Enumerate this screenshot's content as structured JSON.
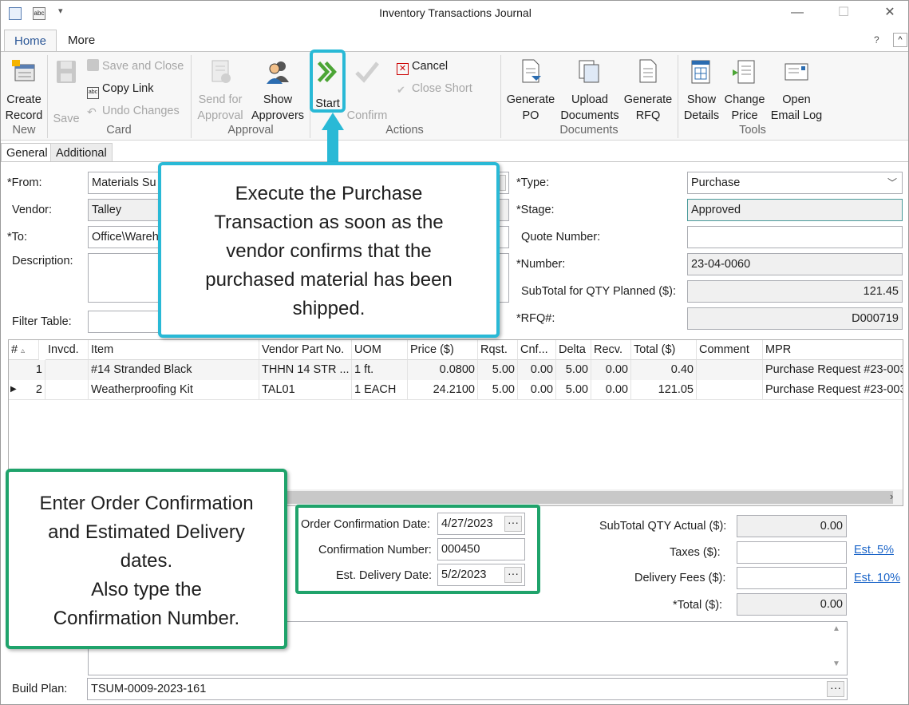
{
  "window": {
    "title": "Inventory Transactions Journal"
  },
  "ribbon_tabs": [
    "Home",
    "More"
  ],
  "ribbon": {
    "new": {
      "create_record": [
        "Create",
        "Record"
      ],
      "label": "New"
    },
    "card": {
      "save": "Save",
      "save_and_close": "Save and Close",
      "copy_link": "Copy Link",
      "undo_changes": "Undo Changes",
      "label": "Card"
    },
    "approval": {
      "send_for_approval": [
        "Send for",
        "Approval"
      ],
      "show_approvers": [
        "Show",
        "Approvers"
      ],
      "label": "Approval"
    },
    "actions": {
      "start": "Start",
      "confirm": "Confirm",
      "cancel": "Cancel",
      "close_short": "Close Short",
      "label": "Actions"
    },
    "documents": {
      "generate_po": [
        "Generate",
        "PO"
      ],
      "upload_documents": [
        "Upload",
        "Documents"
      ],
      "generate_rfq": [
        "Generate",
        "RFQ"
      ],
      "label": "Documents"
    },
    "tools": {
      "show_details": [
        "Show",
        "Details"
      ],
      "change_price": [
        "Change",
        "Price"
      ],
      "open_email_log": [
        "Open",
        "Email Log"
      ],
      "label": "Tools"
    }
  },
  "form_tabs": [
    "General",
    "Additional"
  ],
  "form": {
    "from_label": "*From:",
    "from_value": "Materials Su",
    "vendor_label": "Vendor:",
    "vendor_value": "Talley",
    "to_label": "*To:",
    "to_value": "Office\\Wareh",
    "description_label": "Description:",
    "filter_label": "Filter Table:",
    "type_label": "*Type:",
    "type_value": "Purchase",
    "stage_label": "*Stage:",
    "stage_value": "Approved",
    "quote_label": "Quote Number:",
    "quote_value": "",
    "number_label": "*Number:",
    "number_value": "23-04-0060",
    "subtotal_planned_label": "SubTotal for QTY Planned ($):",
    "subtotal_planned_value": "121.45",
    "rfq_label": "*RFQ#:",
    "rfq_value": "D000719"
  },
  "grid": {
    "columns": [
      "#",
      "Invcd.",
      "Item",
      "Vendor Part No.",
      "UOM",
      "Price ($)",
      "Rqst.",
      "Cnf...",
      "Delta",
      "Recv.",
      "Total ($)",
      "Comment",
      "MPR"
    ],
    "rows": [
      [
        "1",
        "",
        "#14 Stranded Black",
        "THHN 14 STR ...",
        "1 ft.",
        "0.0800",
        "5.00",
        "0.00",
        "5.00",
        "0.00",
        "0.40",
        "",
        "Purchase Request #23-003"
      ],
      [
        "2",
        "",
        "Weatherproofing Kit",
        "TAL01",
        "1 EACH",
        "24.2100",
        "5.00",
        "0.00",
        "5.00",
        "0.00",
        "121.05",
        "",
        "Purchase Request #23-003"
      ]
    ]
  },
  "bottom": {
    "order_conf_date_label": "Order Confirmation Date:",
    "order_conf_date_value": "4/27/2023",
    "conf_number_label": "Confirmation Number:",
    "conf_number_value": "000450",
    "est_delivery_label": "Est. Delivery Date:",
    "est_delivery_value": "5/2/2023",
    "subtotal_actual_label": "SubTotal QTY Actual ($):",
    "subtotal_actual_value": "0.00",
    "taxes_label": "Taxes ($):",
    "taxes_value": "",
    "taxes_link": "Est. 5%",
    "delivery_fees_label": "Delivery Fees ($):",
    "delivery_fees_value": "",
    "delivery_fees_link": "Est. 10%",
    "total_label": "*Total ($):",
    "total_value": "0.00",
    "build_plan_label": "Build Plan:",
    "build_plan_value": "TSUM-0009-2023-161"
  },
  "callouts": {
    "blue": [
      "Execute the Purchase",
      "Transaction as soon as the",
      "vendor confirms that the",
      "purchased material has been",
      "shipped."
    ],
    "green": [
      "Enter Order Confirmation",
      "and Estimated Delivery",
      "dates.",
      "Also type the",
      "Confirmation Number."
    ]
  },
  "colors": {
    "callout_blue": "#29b9d6",
    "callout_green": "#1fa36b",
    "active_tab": "#2b5797",
    "link": "#1a64c8"
  },
  "icons": [
    "save-icon",
    "start-icon",
    "confirm-icon",
    "cancel-icon",
    "close-short-icon",
    "undo-icon",
    "copy-link-icon",
    "generate-po-icon",
    "upload-documents-icon",
    "generate-rfq-icon",
    "show-details-icon",
    "change-price-icon",
    "email-log-icon",
    "approvers-icon",
    "send-approval-icon",
    "create-record-icon"
  ]
}
